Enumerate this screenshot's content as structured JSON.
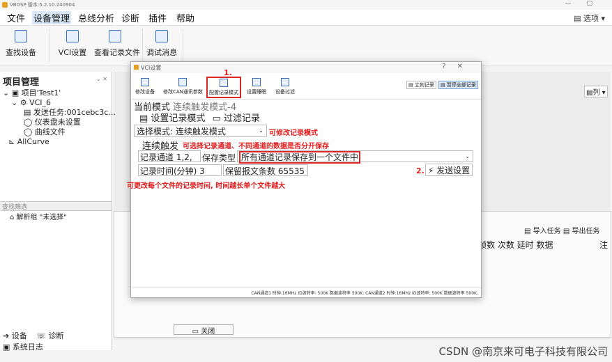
{
  "app": {
    "title": "VBDSP 版本:5.2.10.240904",
    "window_controls": [
      "—",
      "▢"
    ]
  },
  "menu": {
    "items": [
      "文件",
      "设备管理",
      "总线分析",
      "诊断",
      "插件",
      "帮助"
    ],
    "right": "▤ 选项 ▾"
  },
  "ribbon": {
    "buttons": [
      {
        "label": "查找设备",
        "icon": "search-device-icon"
      },
      {
        "label": "VCI设置",
        "icon": "vci-gear-icon"
      },
      {
        "label": "查看记录文件",
        "icon": "document-icon"
      },
      {
        "label": "调试消息",
        "icon": "debug-icon"
      }
    ]
  },
  "left_panel": {
    "title": "项目管理",
    "tree": [
      {
        "text": "⌄ ▣ 项目'Test1'",
        "indent": 0
      },
      {
        "text": "⌄ ⚙ VCI_6",
        "indent": 1
      },
      {
        "text": "▤ 发送任务:001cebc3c...",
        "indent": 2
      },
      {
        "text": "◯ 仪表盘未设置",
        "indent": 2
      },
      {
        "text": "◯ 曲线文件",
        "indent": 2
      },
      {
        "text": "⊾ AllCurve",
        "indent": 1
      }
    ],
    "filter_placeholder": "查找筛选",
    "parse_group": "⌂ 解析组 \"未选择\""
  },
  "bottom_tabs": [
    "➔ 设备",
    "☏ 诊断"
  ],
  "system_log": "▣ 系统日志",
  "right": {
    "import_task": "▤ 导入任务",
    "export_task": "▤ 导出任务",
    "header": "帧数 次数 延时 数据",
    "list_btn": "▤列 ▾",
    "trailing": "注"
  },
  "close_button": "▭ 关闭",
  "dialog": {
    "title": "VCI设置",
    "controls": [
      "?",
      "✕"
    ],
    "toolbar": [
      {
        "label": "修改设备"
      },
      {
        "label": "修改CAN通讯参数"
      },
      {
        "label": "配置记录模式"
      },
      {
        "label": "设置睡眠"
      },
      {
        "label": "设备过滤"
      }
    ],
    "toolbar_right": [
      "▤ 立刻记录",
      "▤ 暂停全部记录"
    ],
    "step1": "1.",
    "current_mode_label": "当前模式",
    "current_mode_value": "连续触发模式-4",
    "tabs": [
      "▤ 设置记录模式",
      "▭ 过滤记录"
    ],
    "select_mode": "选择模式: 连续触发模式",
    "select_mode_note": "可修改记录模式",
    "continuous_trigger": "连续触发",
    "channel_note": "可选择记录通道、不同通道的数据是否分开保存",
    "record_channel": "记录通道 1,2,",
    "save_type_label": "保存类型",
    "save_type_value": "所有通道记录保存到一个文件中",
    "record_time": "记录时间(分钟) 3",
    "keep_msgs": "保留报文条数 65535",
    "step2": "2.",
    "send_settings": "⚡ 发送设置",
    "time_note": "可更改每个文件的记录时间, 时间越长单个文件越大",
    "status": "CAN通道1 时钟:16MHz ID波特率: 500K 数据波特率 500K; CAN通道2 时钟:16MHz ID波特率: 500K 数据波特率 500K;"
  },
  "watermark": "CSDN @南京来可电子科技有限公司"
}
